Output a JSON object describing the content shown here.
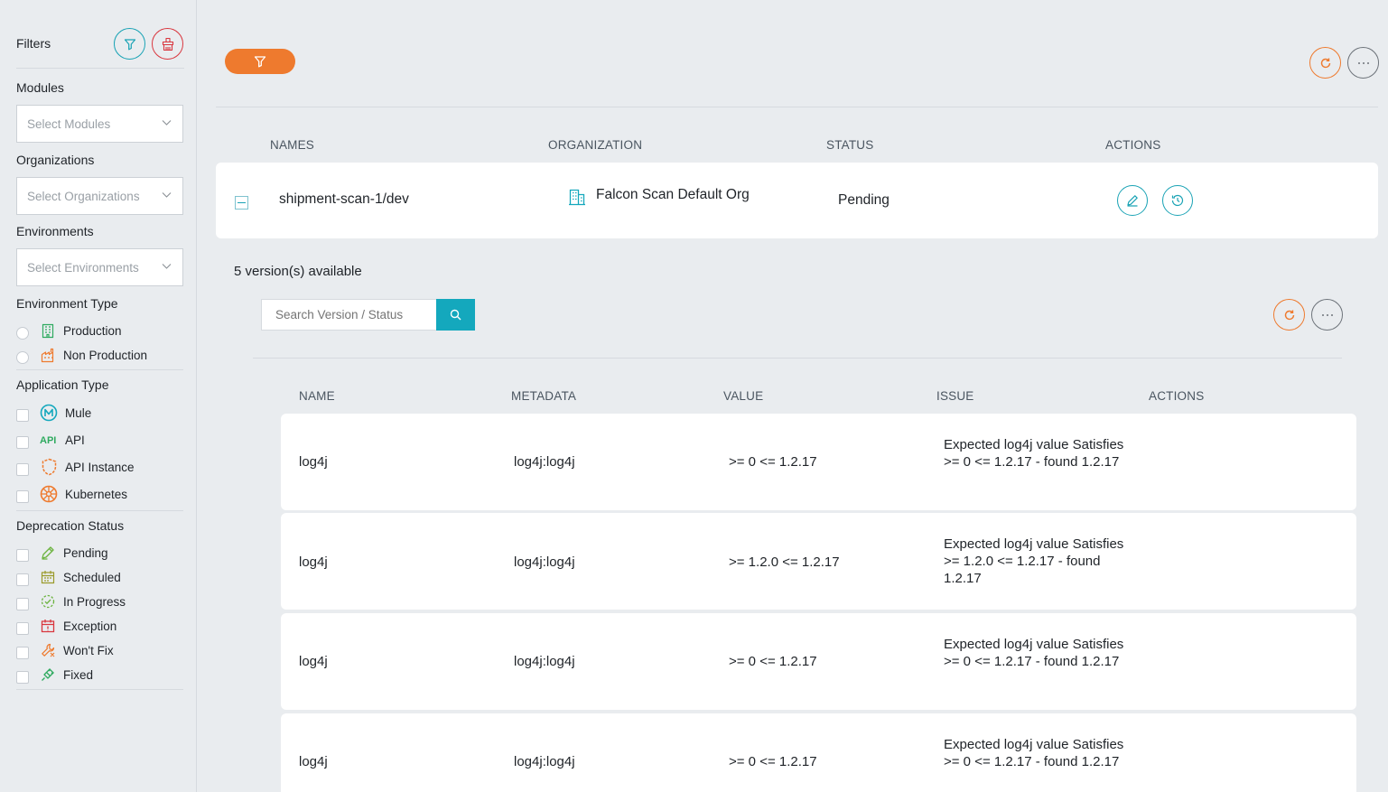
{
  "sidebar": {
    "title": "Filters",
    "modules": {
      "label": "Modules",
      "placeholder": "Select Modules"
    },
    "organizations": {
      "label": "Organizations",
      "placeholder": "Select Organizations"
    },
    "environments": {
      "label": "Environments",
      "placeholder": "Select Environments"
    },
    "environment_type": {
      "label": "Environment Type",
      "options": [
        "Production",
        "Non Production"
      ]
    },
    "application_type": {
      "label": "Application Type",
      "options": [
        "Mule",
        "API",
        "API Instance",
        "Kubernetes"
      ]
    },
    "deprecation_status": {
      "label": "Deprecation Status",
      "options": [
        "Pending",
        "Scheduled",
        "In Progress",
        "Exception",
        "Won't Fix",
        "Fixed"
      ]
    }
  },
  "main": {
    "columns": [
      "NAMES",
      "ORGANIZATION",
      "STATUS",
      "ACTIONS"
    ],
    "app": {
      "name": "shipment-scan-1/dev",
      "organization": "Falcon Scan Default Org",
      "status": "Pending"
    },
    "versions_available": "5 version(s) available",
    "search_placeholder": "Search Version / Status",
    "version_columns": [
      "NAME",
      "METADATA",
      "VALUE",
      "ISSUE",
      "ACTIONS"
    ],
    "rows": [
      {
        "name": "log4j",
        "metadata": "log4j:log4j",
        "value": ">= 0 <= 1.2.17",
        "issue": "Expected log4j value Satisfies >= 0 <= 1.2.17 - found 1.2.17"
      },
      {
        "name": "log4j",
        "metadata": "log4j:log4j",
        "value": ">= 1.2.0 <= 1.2.17",
        "issue": "Expected log4j value Satisfies >= 1.2.0 <= 1.2.17 - found 1.2.17"
      },
      {
        "name": "log4j",
        "metadata": "log4j:log4j",
        "value": ">= 0 <= 1.2.17",
        "issue": "Expected log4j value Satisfies >= 0 <= 1.2.17 - found 1.2.17"
      },
      {
        "name": "log4j",
        "metadata": "log4j:log4j",
        "value": ">= 0 <= 1.2.17",
        "issue": "Expected log4j value Satisfies >= 0 <= 1.2.17 - found 1.2.17"
      }
    ]
  },
  "colors": {
    "accent_teal": "#14a8bd",
    "accent_orange": "#ee7a2e",
    "danger_red": "#d9363e",
    "background": "#e9ecef"
  }
}
